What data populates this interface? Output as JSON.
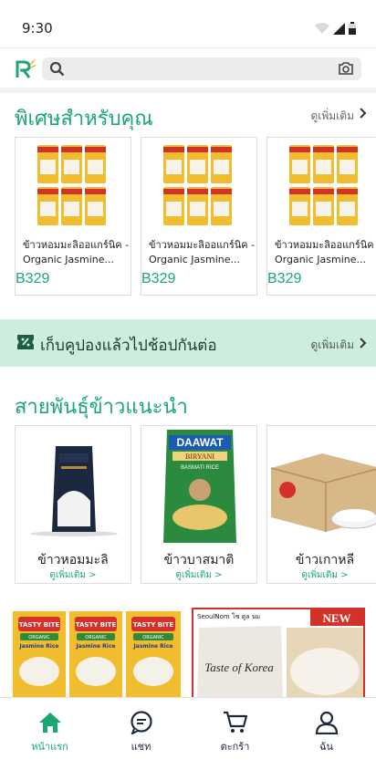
{
  "status": {
    "time": "9:30"
  },
  "header": {
    "search_placeholder": ""
  },
  "special": {
    "title": "พิเศษสำหรับคุณ",
    "more_label": "ดูเพิ่มเติม",
    "products": [
      {
        "name_line1": "ข้าวหอมมะลิออแกร์นิค -",
        "name_line2": "Organic Jasmine...",
        "price": "B329"
      },
      {
        "name_line1": "ข้าวหอมมะลิออแกร์นิค -",
        "name_line2": "Organic Jasmine...",
        "price": "B329"
      },
      {
        "name_line1": "ข้าวหอมมะลิออแกร์นิค -",
        "name_line2": "Organic Jasmine...",
        "price": "B329"
      }
    ]
  },
  "coupon": {
    "text": "เก็บคูปองแล้วไปช้อปกันต่อ",
    "more_label": "ดูเพิ่มเติม"
  },
  "varieties": {
    "title": "สายพันธุ์ข้าวแนะนำ",
    "items": [
      {
        "name": "ข้าวหอมมะลิ",
        "more": "ดูเพิ่มเติม >"
      },
      {
        "name": "ข้าวบาสมาติ",
        "more": "ดูเพิ่มเติม >"
      },
      {
        "name": "ข้าวเกาหลี",
        "more": "ดูเพิ่มเติม >"
      }
    ],
    "package_texts": {
      "daawat": "DAAWAT",
      "biryani": "BIRYANI",
      "basmati": "BASMATI RICE"
    }
  },
  "banners": {
    "tasty_bite": {
      "brand": "TASTY BITE",
      "organic": "ORGANIC",
      "product": "Jasmine Rice"
    },
    "seoulnom": {
      "title": "SeoulNom โซ ตูล นม",
      "badge": "NEW",
      "package": "Taste of Korea"
    }
  },
  "nav": {
    "items": [
      {
        "label": "หน้าแรก",
        "icon": "home-icon"
      },
      {
        "label": "แชท",
        "icon": "chat-icon"
      },
      {
        "label": "ตะกร้า",
        "icon": "cart-icon"
      },
      {
        "label": "ฉัน",
        "icon": "user-icon"
      }
    ]
  },
  "colors": {
    "brand_green": "#1aa773",
    "coupon_bg": "#cdeedd",
    "tasty_red": "#d5312b",
    "tasty_yellow": "#f1bd2f"
  }
}
